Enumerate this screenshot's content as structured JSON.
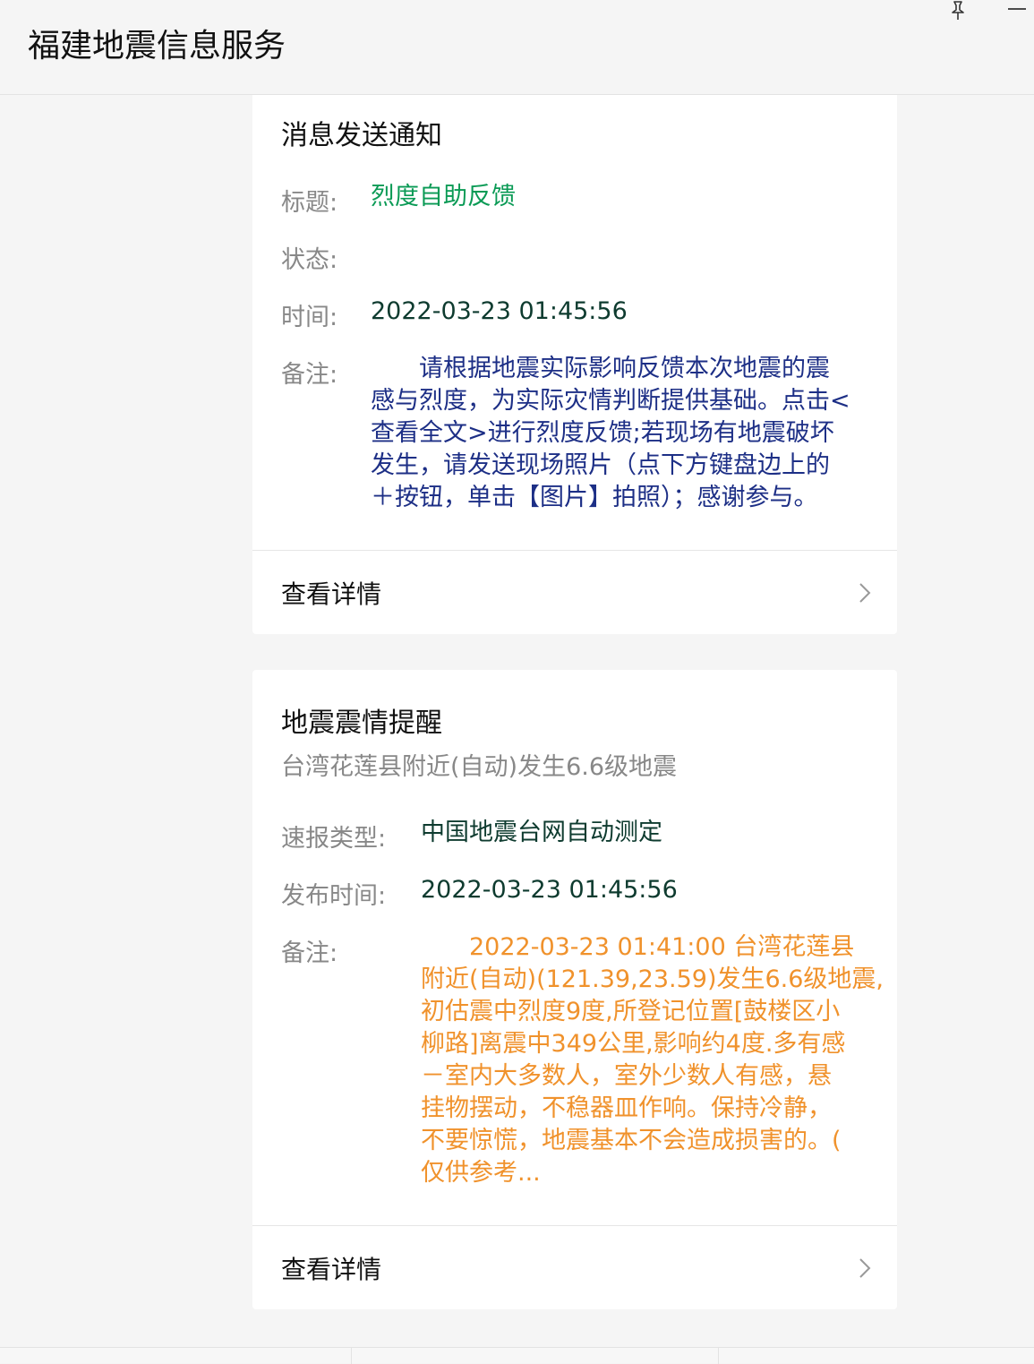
{
  "header": {
    "title": "福建地震信息服务"
  },
  "notice_card": {
    "title": "消息发送通知",
    "rows": [
      {
        "label": "标题:",
        "value": "烈度自助反馈"
      },
      {
        "label": "状态:",
        "value": ""
      },
      {
        "label": "时间:",
        "value": "2022-03-23 01:45:56"
      },
      {
        "label": "备注:",
        "value_lines": [
          "　　请根据地震实际影响反馈本次地震的震",
          "感与烈度，为实际灾情判断提供基础。点击<",
          "查看全文>进行烈度反馈;若现场有地震破坏",
          "发生，请发送现场照片（点下方键盘边上的",
          "＋按钮，单击【图片】拍照）；感谢参与。"
        ]
      }
    ],
    "detail_label": "查看详情"
  },
  "quake_card": {
    "title": "地震震情提醒",
    "subtitle": "台湾花莲县附近(自动)发生6.6级地震",
    "rows": [
      {
        "label": "速报类型:",
        "value": "中国地震台网自动测定"
      },
      {
        "label": "发布时间:",
        "value": "2022-03-23 01:45:56"
      },
      {
        "label": "备注:",
        "value_lines": [
          "　　2022-03-23 01:41:00 台湾花莲县",
          "附近(自动)(121.39,23.59)发生6.6级地震,",
          "初估震中烈度9度,所登记位置[鼓楼区小",
          "柳路]离震中349公里,影响约4度.多有感",
          "－室内大多数人，室外少数人有感，悬",
          "挂物摆动，不稳器皿作响。保持冷静，",
          "不要惊慌，地震基本不会造成损害的。(",
          "仅供参考..."
        ]
      }
    ],
    "detail_label": "查看详情"
  },
  "colors": {
    "green": "#0a9a55",
    "dark_value": "#0e3b2f",
    "navy": "#1d2f86",
    "orange": "#f0922c"
  },
  "icons": {
    "pin": "pin-icon",
    "minimize": "minimize-icon",
    "chevron": "chevron-right-icon"
  }
}
